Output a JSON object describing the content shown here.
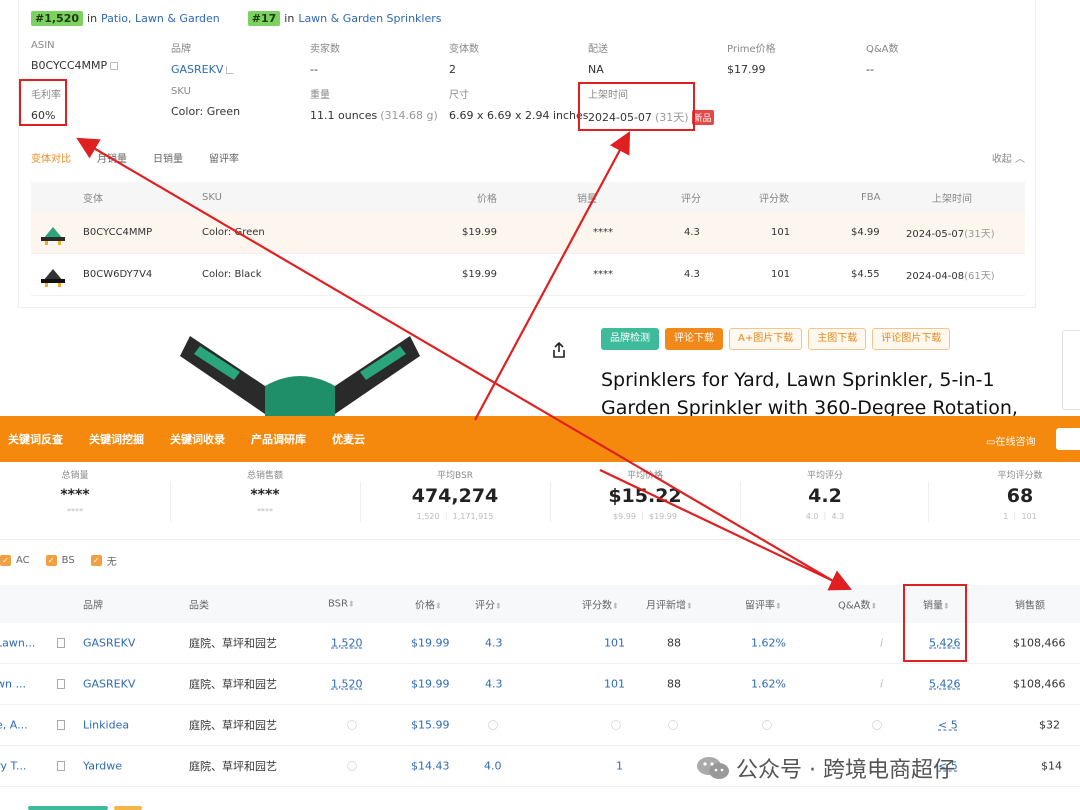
{
  "ranks": [
    {
      "badge": "#1,520",
      "in": "in",
      "category": "Patio, Lawn & Garden"
    },
    {
      "badge": "#17",
      "in": "in",
      "category": "Lawn & Garden Sprinklers"
    }
  ],
  "info": {
    "asin": {
      "label": "ASIN",
      "value": "B0CYCC4MMP"
    },
    "brand": {
      "label": "品牌",
      "value": "GASREKV"
    },
    "sellers": {
      "label": "卖家数",
      "value": "--"
    },
    "variants": {
      "label": "变体数",
      "value": "2"
    },
    "delivery": {
      "label": "配送",
      "value": "NA"
    },
    "prime": {
      "label": "Prime价格",
      "value": "$17.99"
    },
    "qa": {
      "label": "Q&A数",
      "value": "--"
    },
    "margin": {
      "label": "毛利率",
      "value": "60%"
    },
    "sku": {
      "label": "SKU",
      "value": "Color: Green"
    },
    "weight": {
      "label": "重量",
      "value": "11.1 ounces",
      "muted": "(314.68 g)"
    },
    "size": {
      "label": "尺寸",
      "value": "6.69 x 6.69 x 2.94 inches"
    },
    "listed": {
      "label": "上架时间",
      "value": "2024-05-07",
      "muted": "(31天)",
      "badge": "新品"
    }
  },
  "tabs": [
    "变体对比",
    "月销量",
    "日销量",
    "留评率"
  ],
  "collapse": "收起",
  "variant_table": {
    "headers": [
      "变体",
      "SKU",
      "价格",
      "销量",
      "评分",
      "评分数",
      "FBA",
      "上架时间"
    ],
    "rows": [
      {
        "asin": "B0CYCC4MMP",
        "sku": "Color: Green",
        "price": "$19.99",
        "sales": "****",
        "rating": "4.3",
        "reviews": "101",
        "fba": "$4.99",
        "date": "2024-05-07",
        "age": "(31天)"
      },
      {
        "asin": "B0CW6DY7V4",
        "sku": "Color: Black",
        "price": "$19.99",
        "sales": "****",
        "rating": "4.3",
        "reviews": "101",
        "fba": "$4.55",
        "date": "2024-04-08",
        "age": "(61天)"
      }
    ]
  },
  "tool_buttons": [
    "品牌检测",
    "评论下载",
    "A+图片下载",
    "主图下载",
    "评论图片下载"
  ],
  "product_title": "Sprinklers for Yard, Lawn Sprinkler, 5-in-1 Garden Sprinkler with 360-Degree Rotation,",
  "nav": [
    "关键词反查",
    "关键词挖掘",
    "关键词收录",
    "产品调研库",
    "优麦云"
  ],
  "consult": "在线咨询",
  "stats": [
    {
      "label": "总销量",
      "value": "****",
      "sub": "****"
    },
    {
      "label": "总销售额",
      "value": "****",
      "sub": "****"
    },
    {
      "label": "平均BSR",
      "value": "474,274",
      "sub": "1,520 ｜ 1,171,915"
    },
    {
      "label": "平均价格",
      "value": "$15.22",
      "sub": "$9.99 ｜ $19.99"
    },
    {
      "label": "平均评分",
      "value": "4.2",
      "sub": "4.0 ｜ 4.3"
    },
    {
      "label": "平均评分数",
      "value": "68",
      "sub": "1 ｜ 101"
    }
  ],
  "filters": [
    "AC",
    "BS",
    "无"
  ],
  "results": {
    "headers": [
      "品牌",
      "品类",
      "BSR",
      "价格",
      "评分",
      "评分数",
      "月评新增",
      "留评率",
      "Q&A数",
      "销量",
      "销售额"
    ],
    "rows": [
      {
        "title": "Lawn...",
        "brand": "GASREKV",
        "category": "庭院、草坪和园艺",
        "bsr": "1,520",
        "price": "$19.99",
        "rating": "4.3",
        "reviews": "101",
        "new_reviews": "88",
        "review_rate": "1.62%",
        "qa": "i",
        "sales": "5,426",
        "revenue": "$108,466"
      },
      {
        "title": "wn ...",
        "brand": "GASREKV",
        "category": "庭院、草坪和园艺",
        "bsr": "1,520",
        "price": "$19.99",
        "rating": "4.3",
        "reviews": "101",
        "new_reviews": "88",
        "review_rate": "1.62%",
        "qa": "i",
        "sales": "5,426",
        "revenue": "$108,466"
      },
      {
        "title": "e, A...",
        "brand": "Linkidea",
        "category": "庭院、草坪和园艺",
        "bsr": "",
        "price": "$15.99",
        "rating": "",
        "reviews": "",
        "new_reviews": "",
        "review_rate": "",
        "qa": "",
        "sales": "< 5",
        "revenue": "$32"
      },
      {
        "title": "ry T...",
        "brand": "Yardwe",
        "category": "庭院、草坪和园艺",
        "bsr": "",
        "price": "$14.43",
        "rating": "4.0",
        "reviews": "1",
        "new_reviews": "",
        "review_rate": "",
        "qa": "",
        "sales": "< 5",
        "revenue": "$14"
      }
    ]
  },
  "watermark": "公众号 · 跨境电商超仔",
  "colors": {
    "accent": "#f5890e",
    "link": "#2e6bb5",
    "annotation": "#e02020",
    "rank_badge": "#7cd160"
  }
}
